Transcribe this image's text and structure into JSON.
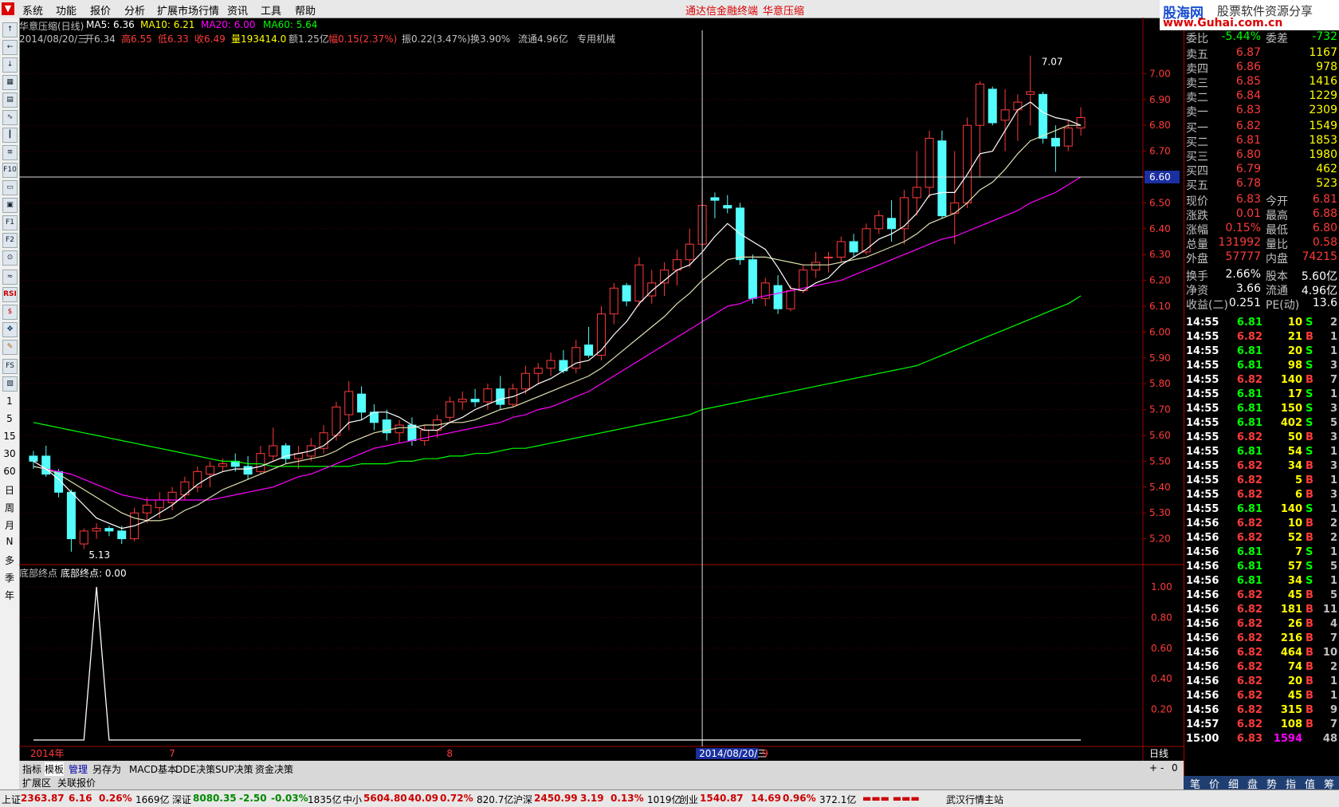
{
  "menubar": {
    "items": [
      "系统",
      "功能",
      "报价",
      "分析",
      "扩展市场行情",
      "资讯",
      "工具",
      "帮助"
    ],
    "center_title": "通达信金融终端",
    "stock_name": "华意压缩"
  },
  "brand": {
    "name": "股海网",
    "slogan": "股票软件资源分享",
    "url": "www.Guhai.com.cn"
  },
  "toolbar": {
    "icons": [
      "up-arrow",
      "left-arrow",
      "down-arrow",
      "grid",
      "table",
      "line-chart",
      "kline",
      "list",
      "f10",
      "doc",
      "doc2",
      "f1",
      "f2",
      "zoom",
      "wave",
      "RSI",
      "dollar",
      "move",
      "pencil",
      "FS",
      "snapshot"
    ],
    "periods": [
      "1",
      "5",
      "15",
      "30",
      "60",
      "日",
      "周",
      "月",
      "N",
      "多",
      "季",
      "年"
    ]
  },
  "chart_header": {
    "line1_name": "华意压缩(日线)",
    "ma5": "MA5: 6.36",
    "ma10": "MA10: 6.21",
    "ma20": "MA20: 6.00",
    "ma60": "MA60: 5.64",
    "date": "2014/08/20/三",
    "open": "开6.34",
    "high": "高6.55",
    "low": "低6.33",
    "close": "收6.49",
    "vol": "量193414.0",
    "amt": "额1.25亿",
    "change": "幅0.15(2.37%)",
    "amp": "振0.22(3.47%)",
    "turnover": "换3.90%",
    "float": "流通4.96亿",
    "industry": "专用机械"
  },
  "indicator": {
    "name": "底部终点",
    "label": "底部终点: 0.00"
  },
  "colors": {
    "up": "#ff3b3b",
    "down": "#54fcfc",
    "ma5": "#ffffff",
    "ma10": "#ffff00",
    "ma20": "#ff00ff",
    "ma60": "#00ff00",
    "grid": "#a00000"
  },
  "chart_data": {
    "type": "candlestick",
    "price_axis": [
      "7.00",
      "6.90",
      "6.80",
      "6.70",
      "6.60",
      "6.50",
      "6.40",
      "6.30",
      "6.20",
      "6.10",
      "6.00",
      "5.90",
      "5.80",
      "5.70",
      "5.60",
      "5.50",
      "5.40",
      "5.30",
      "5.20"
    ],
    "ylim": [
      5.1,
      7.1
    ],
    "cursor_price": "6.60",
    "indicator_axis": [
      "1.00",
      "0.80",
      "0.60",
      "0.40",
      "0.20"
    ],
    "x_labels": [
      "2014年",
      "7",
      "8",
      "2014/08/20/三",
      "9"
    ],
    "period_label": "日线",
    "annotations": {
      "high_label": "7.07",
      "low_label": "5.13"
    },
    "candles": [
      [
        5.52,
        5.54,
        5.47,
        5.5
      ],
      [
        5.52,
        5.56,
        5.44,
        5.45
      ],
      [
        5.46,
        5.47,
        5.36,
        5.38
      ],
      [
        5.38,
        5.39,
        5.15,
        5.2
      ],
      [
        5.18,
        5.24,
        5.16,
        5.23
      ],
      [
        5.23,
        5.26,
        5.2,
        5.24
      ],
      [
        5.24,
        5.25,
        5.21,
        5.23
      ],
      [
        5.23,
        5.25,
        5.18,
        5.2
      ],
      [
        5.2,
        5.32,
        5.19,
        5.3
      ],
      [
        5.3,
        5.36,
        5.26,
        5.33
      ],
      [
        5.32,
        5.38,
        5.28,
        5.35
      ],
      [
        5.34,
        5.4,
        5.31,
        5.38
      ],
      [
        5.37,
        5.44,
        5.35,
        5.42
      ],
      [
        5.4,
        5.48,
        5.38,
        5.46
      ],
      [
        5.45,
        5.5,
        5.4,
        5.48
      ],
      [
        5.48,
        5.51,
        5.46,
        5.49
      ],
      [
        5.5,
        5.53,
        5.46,
        5.48
      ],
      [
        5.48,
        5.52,
        5.43,
        5.45
      ],
      [
        5.46,
        5.56,
        5.45,
        5.53
      ],
      [
        5.52,
        5.63,
        5.5,
        5.56
      ],
      [
        5.56,
        5.57,
        5.49,
        5.51
      ],
      [
        5.51,
        5.56,
        5.47,
        5.53
      ],
      [
        5.52,
        5.59,
        5.5,
        5.56
      ],
      [
        5.55,
        5.64,
        5.53,
        5.61
      ],
      [
        5.6,
        5.73,
        5.58,
        5.71
      ],
      [
        5.68,
        5.81,
        5.62,
        5.77
      ],
      [
        5.76,
        5.79,
        5.66,
        5.69
      ],
      [
        5.69,
        5.72,
        5.62,
        5.65
      ],
      [
        5.66,
        5.7,
        5.58,
        5.61
      ],
      [
        5.61,
        5.66,
        5.57,
        5.64
      ],
      [
        5.64,
        5.67,
        5.56,
        5.58
      ],
      [
        5.58,
        5.64,
        5.56,
        5.62
      ],
      [
        5.62,
        5.68,
        5.59,
        5.66
      ],
      [
        5.67,
        5.75,
        5.65,
        5.73
      ],
      [
        5.73,
        5.77,
        5.7,
        5.74
      ],
      [
        5.74,
        5.78,
        5.71,
        5.73
      ],
      [
        5.73,
        5.8,
        5.7,
        5.78
      ],
      [
        5.78,
        5.83,
        5.7,
        5.72
      ],
      [
        5.72,
        5.8,
        5.71,
        5.78
      ],
      [
        5.78,
        5.87,
        5.76,
        5.84
      ],
      [
        5.84,
        5.88,
        5.8,
        5.86
      ],
      [
        5.86,
        5.92,
        5.83,
        5.89
      ],
      [
        5.89,
        5.93,
        5.84,
        5.85
      ],
      [
        5.86,
        5.97,
        5.84,
        5.94
      ],
      [
        5.95,
        6.02,
        5.9,
        5.91
      ],
      [
        5.91,
        6.1,
        5.89,
        6.07
      ],
      [
        6.07,
        6.19,
        6.03,
        6.17
      ],
      [
        6.18,
        6.19,
        6.1,
        6.12
      ],
      [
        6.12,
        6.29,
        6.1,
        6.26
      ],
      [
        6.14,
        6.24,
        6.11,
        6.19
      ],
      [
        6.19,
        6.27,
        6.14,
        6.24
      ],
      [
        6.24,
        6.32,
        6.18,
        6.28
      ],
      [
        6.28,
        6.4,
        6.25,
        6.34
      ],
      [
        6.34,
        6.55,
        6.33,
        6.49
      ],
      [
        6.52,
        6.54,
        6.44,
        6.51
      ],
      [
        6.49,
        6.53,
        6.46,
        6.48
      ],
      [
        6.48,
        6.5,
        6.26,
        6.28
      ],
      [
        6.28,
        6.3,
        6.11,
        6.13
      ],
      [
        6.13,
        6.21,
        6.1,
        6.19
      ],
      [
        6.18,
        6.22,
        6.07,
        6.09
      ],
      [
        6.09,
        6.18,
        6.08,
        6.16
      ],
      [
        6.16,
        6.26,
        6.15,
        6.24
      ],
      [
        6.24,
        6.31,
        6.21,
        6.27
      ],
      [
        6.29,
        6.31,
        6.23,
        6.29
      ],
      [
        6.29,
        6.37,
        6.27,
        6.35
      ],
      [
        6.35,
        6.38,
        6.29,
        6.31
      ],
      [
        6.31,
        6.42,
        6.3,
        6.4
      ],
      [
        6.4,
        6.47,
        6.38,
        6.45
      ],
      [
        6.44,
        6.51,
        6.35,
        6.4
      ],
      [
        6.4,
        6.55,
        6.34,
        6.52
      ],
      [
        6.52,
        6.7,
        6.45,
        6.56
      ],
      [
        6.56,
        6.78,
        6.52,
        6.75
      ],
      [
        6.74,
        6.78,
        6.44,
        6.45
      ],
      [
        6.46,
        6.7,
        6.34,
        6.5
      ],
      [
        6.5,
        6.83,
        6.48,
        6.8
      ],
      [
        6.8,
        6.97,
        6.6,
        6.96
      ],
      [
        6.94,
        6.95,
        6.8,
        6.81
      ],
      [
        6.82,
        6.94,
        6.7,
        6.86
      ],
      [
        6.86,
        6.92,
        6.74,
        6.89
      ],
      [
        6.92,
        7.07,
        6.8,
        6.93
      ],
      [
        6.92,
        6.93,
        6.73,
        6.75
      ],
      [
        6.75,
        6.8,
        6.62,
        6.72
      ],
      [
        6.72,
        6.82,
        6.7,
        6.79
      ],
      [
        6.79,
        6.87,
        6.76,
        6.83
      ]
    ],
    "ma5": [
      5.5,
      5.47,
      5.43,
      5.38,
      5.33,
      5.28,
      5.26,
      5.24,
      5.25,
      5.27,
      5.3,
      5.33,
      5.37,
      5.41,
      5.44,
      5.46,
      5.47,
      5.47,
      5.48,
      5.5,
      5.52,
      5.53,
      5.54,
      5.56,
      5.6,
      5.65,
      5.66,
      5.69,
      5.69,
      5.67,
      5.64,
      5.62,
      5.62,
      5.65,
      5.67,
      5.7,
      5.72,
      5.74,
      5.75,
      5.77,
      5.8,
      5.82,
      5.85,
      5.88,
      5.89,
      5.93,
      5.99,
      6.04,
      6.11,
      6.16,
      6.2,
      6.24,
      6.26,
      6.31,
      6.37,
      6.42,
      6.38,
      6.35,
      6.32,
      6.25,
      6.17,
      6.16,
      6.19,
      6.21,
      6.26,
      6.29,
      6.32,
      6.36,
      6.38,
      6.41,
      6.46,
      6.53,
      6.54,
      6.54,
      6.61,
      6.69,
      6.7,
      6.78,
      6.86,
      6.89,
      6.85,
      6.83,
      6.82,
      6.8
    ],
    "ma10": [
      5.48,
      5.47,
      5.45,
      5.42,
      5.39,
      5.36,
      5.33,
      5.3,
      5.28,
      5.27,
      5.27,
      5.28,
      5.31,
      5.33,
      5.36,
      5.39,
      5.41,
      5.43,
      5.45,
      5.47,
      5.49,
      5.5,
      5.51,
      5.52,
      5.54,
      5.57,
      5.59,
      5.61,
      5.62,
      5.63,
      5.63,
      5.64,
      5.64,
      5.65,
      5.65,
      5.66,
      5.68,
      5.7,
      5.71,
      5.73,
      5.75,
      5.77,
      5.79,
      5.81,
      5.83,
      5.86,
      5.9,
      5.94,
      5.98,
      6.02,
      6.06,
      6.11,
      6.15,
      6.2,
      6.24,
      6.28,
      6.29,
      6.29,
      6.29,
      6.28,
      6.27,
      6.26,
      6.26,
      6.26,
      6.27,
      6.28,
      6.29,
      6.31,
      6.33,
      6.35,
      6.38,
      6.42,
      6.44,
      6.46,
      6.5,
      6.55,
      6.58,
      6.63,
      6.69,
      6.74,
      6.76,
      6.78,
      6.8,
      6.8
    ],
    "ma20": [
      5.48,
      5.47,
      5.46,
      5.45,
      5.43,
      5.41,
      5.39,
      5.37,
      5.36,
      5.35,
      5.35,
      5.35,
      5.35,
      5.35,
      5.35,
      5.36,
      5.37,
      5.38,
      5.39,
      5.4,
      5.42,
      5.44,
      5.45,
      5.47,
      5.49,
      5.51,
      5.53,
      5.55,
      5.56,
      5.57,
      5.58,
      5.59,
      5.6,
      5.61,
      5.62,
      5.63,
      5.64,
      5.65,
      5.67,
      5.68,
      5.7,
      5.71,
      5.73,
      5.75,
      5.77,
      5.8,
      5.83,
      5.86,
      5.89,
      5.92,
      5.95,
      5.98,
      6.01,
      6.04,
      6.07,
      6.1,
      6.11,
      6.13,
      6.14,
      6.15,
      6.16,
      6.17,
      6.18,
      6.19,
      6.2,
      6.22,
      6.24,
      6.26,
      6.28,
      6.3,
      6.32,
      6.34,
      6.36,
      6.37,
      6.39,
      6.41,
      6.43,
      6.45,
      6.47,
      6.5,
      6.52,
      6.54,
      6.57,
      6.6
    ],
    "ma60": [
      5.65,
      5.64,
      5.63,
      5.62,
      5.61,
      5.6,
      5.59,
      5.58,
      5.57,
      5.56,
      5.55,
      5.54,
      5.53,
      5.52,
      5.51,
      5.5,
      5.5,
      5.49,
      5.49,
      5.48,
      5.48,
      5.48,
      5.48,
      5.48,
      5.48,
      5.48,
      5.49,
      5.49,
      5.49,
      5.5,
      5.5,
      5.51,
      5.51,
      5.52,
      5.52,
      5.53,
      5.53,
      5.54,
      5.55,
      5.55,
      5.56,
      5.57,
      5.58,
      5.59,
      5.6,
      5.61,
      5.62,
      5.63,
      5.64,
      5.65,
      5.66,
      5.67,
      5.68,
      5.7,
      5.71,
      5.72,
      5.73,
      5.74,
      5.75,
      5.76,
      5.77,
      5.78,
      5.79,
      5.8,
      5.81,
      5.82,
      5.83,
      5.84,
      5.85,
      5.86,
      5.87,
      5.89,
      5.91,
      5.93,
      5.95,
      5.97,
      5.99,
      6.01,
      6.03,
      6.05,
      6.07,
      6.09,
      6.11,
      6.14
    ],
    "indicator_values": [
      0,
      0,
      0,
      0,
      0,
      1,
      0,
      0,
      0,
      0,
      0,
      0,
      0,
      0,
      0,
      0,
      0,
      0,
      0,
      0,
      0,
      0,
      0,
      0,
      0,
      0,
      0,
      0,
      0,
      0,
      0,
      0,
      0,
      0,
      0,
      0,
      0,
      0,
      0,
      0,
      0,
      0,
      0,
      0,
      0,
      0,
      0,
      0,
      0,
      0,
      0,
      0,
      0,
      0,
      0,
      0,
      0,
      0,
      0,
      0,
      0,
      0,
      0,
      0,
      0,
      0,
      0,
      0,
      0,
      0,
      0,
      0,
      0,
      0,
      0,
      0,
      0,
      0,
      0,
      0,
      0,
      0,
      0,
      0
    ]
  },
  "quote": {
    "top": [
      {
        "l": "委比",
        "v": "-5.44%",
        "l2": "委差",
        "v2": "-732"
      }
    ],
    "asks": [
      {
        "l": "卖五",
        "p": "6.87",
        "q": "1167"
      },
      {
        "l": "卖四",
        "p": "6.86",
        "q": "978"
      },
      {
        "l": "卖三",
        "p": "6.85",
        "q": "1416"
      },
      {
        "l": "卖二",
        "p": "6.84",
        "q": "1229"
      },
      {
        "l": "卖一",
        "p": "6.83",
        "q": "2309"
      }
    ],
    "bids": [
      {
        "l": "买一",
        "p": "6.82",
        "q": "1549"
      },
      {
        "l": "买二",
        "p": "6.81",
        "q": "1853"
      },
      {
        "l": "买三",
        "p": "6.80",
        "q": "1980"
      },
      {
        "l": "买四",
        "p": "6.79",
        "q": "462"
      },
      {
        "l": "买五",
        "p": "6.78",
        "q": "523"
      }
    ],
    "stats": [
      {
        "l": "现价",
        "v": "6.83",
        "l2": "今开",
        "v2": "6.81"
      },
      {
        "l": "涨跌",
        "v": "0.01",
        "l2": "最高",
        "v2": "6.88"
      },
      {
        "l": "涨幅",
        "v": "0.15%",
        "l2": "最低",
        "v2": "6.80"
      },
      {
        "l": "总量",
        "v": "131992",
        "l2": "量比",
        "v2": "0.58"
      },
      {
        "l": "外盘",
        "v": "57777",
        "l2": "内盘",
        "v2": "74215"
      }
    ],
    "fund": [
      {
        "l": "换手",
        "v": "2.66%",
        "l2": "股本",
        "v2": "5.60亿"
      },
      {
        "l": "净资",
        "v": "3.66",
        "l2": "流通",
        "v2": "4.96亿"
      },
      {
        "l": "收益(二)",
        "v": "0.251",
        "l2": "PE(动)",
        "v2": "13.6"
      }
    ],
    "ticks": [
      [
        "14:55",
        "6.81",
        "10",
        "S",
        "2"
      ],
      [
        "14:55",
        "6.82",
        "21",
        "B",
        "1"
      ],
      [
        "14:55",
        "6.81",
        "20",
        "S",
        "1"
      ],
      [
        "14:55",
        "6.81",
        "98",
        "S",
        "3"
      ],
      [
        "14:55",
        "6.82",
        "140",
        "B",
        "7"
      ],
      [
        "14:55",
        "6.81",
        "17",
        "S",
        "1"
      ],
      [
        "14:55",
        "6.81",
        "150",
        "S",
        "3"
      ],
      [
        "14:55",
        "6.81",
        "402",
        "S",
        "5"
      ],
      [
        "14:55",
        "6.82",
        "50",
        "B",
        "3"
      ],
      [
        "14:55",
        "6.81",
        "54",
        "S",
        "1"
      ],
      [
        "14:55",
        "6.82",
        "34",
        "B",
        "3"
      ],
      [
        "14:55",
        "6.82",
        "5",
        "B",
        "1"
      ],
      [
        "14:55",
        "6.82",
        "6",
        "B",
        "3"
      ],
      [
        "14:55",
        "6.81",
        "140",
        "S",
        "1"
      ],
      [
        "14:56",
        "6.82",
        "10",
        "B",
        "2"
      ],
      [
        "14:56",
        "6.82",
        "52",
        "B",
        "2"
      ],
      [
        "14:56",
        "6.81",
        "7",
        "S",
        "1"
      ],
      [
        "14:56",
        "6.81",
        "57",
        "S",
        "5"
      ],
      [
        "14:56",
        "6.81",
        "34",
        "S",
        "1"
      ],
      [
        "14:56",
        "6.82",
        "45",
        "B",
        "5"
      ],
      [
        "14:56",
        "6.82",
        "181",
        "B",
        "11"
      ],
      [
        "14:56",
        "6.82",
        "26",
        "B",
        "4"
      ],
      [
        "14:56",
        "6.82",
        "216",
        "B",
        "7"
      ],
      [
        "14:56",
        "6.82",
        "464",
        "B",
        "10"
      ],
      [
        "14:56",
        "6.82",
        "74",
        "B",
        "2"
      ],
      [
        "14:56",
        "6.82",
        "20",
        "B",
        "1"
      ],
      [
        "14:56",
        "6.82",
        "45",
        "B",
        "1"
      ],
      [
        "14:56",
        "6.82",
        "315",
        "B",
        "9"
      ],
      [
        "14:57",
        "6.82",
        "108",
        "B",
        "7"
      ],
      [
        "15:00",
        "6.83",
        "1594",
        "",
        "48"
      ]
    ],
    "tabs": [
      "笔",
      "价",
      "细",
      "盘",
      "势",
      "指",
      "值",
      "筹"
    ]
  },
  "bottom_tabs": [
    "指标",
    "模板",
    "管理",
    "另存为",
    "MACD基本",
    "DDE决策",
    "SUP决策",
    "资金决策"
  ],
  "bottom_tabs2": [
    "扩展区",
    "关联报价"
  ],
  "status": {
    "sh_label": "上证",
    "sh": "2363.87",
    "sh_chg": "6.16",
    "sh_pct": "0.26%",
    "sh_amt": "1669亿",
    "sz_label": "深证",
    "sz": "8080.35",
    "sz_chg": "-2.50",
    "sz_pct": "-0.03%",
    "sz_amt": "1835亿",
    "zx_label": "中小",
    "zx": "5604.80",
    "zx_chg": "40.09",
    "zx_pct": "0.72%",
    "zx_amt": "820.7亿",
    "hs_label": "沪深",
    "hs": "2450.99",
    "hs_chg": "3.19",
    "hs_pct": "0.13%",
    "hs_amt": "1019亿",
    "cy_label": "创业",
    "cy": "1540.87",
    "cy_chg": "14.69",
    "cy_pct": "0.96%",
    "cy_amt": "372.1亿",
    "server": "武汉行情主站"
  }
}
